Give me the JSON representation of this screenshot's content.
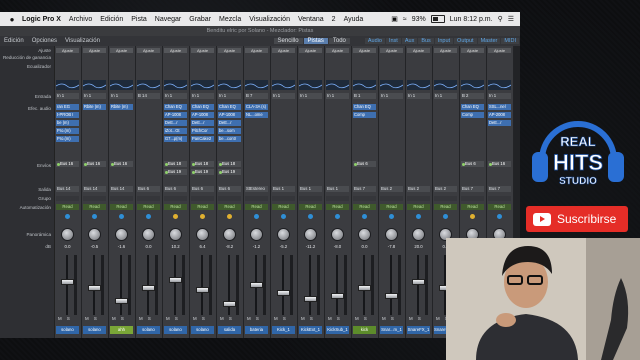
{
  "menubar": {
    "apple": "",
    "app": "Logic Pro X",
    "items": [
      "Archivo",
      "Edición",
      "Pista",
      "Navegar",
      "Grabar",
      "Mezcla",
      "Visualización",
      "Ventana",
      "2",
      "Ayuda"
    ],
    "battery": "93%",
    "clock": "Lun 8:12 p.m."
  },
  "window": {
    "title": "Benditu elric por Solano - Mezclador: Pistas",
    "toolbar": {
      "edit": "Edición",
      "options": "Opciones",
      "view": "Visualización",
      "modes": [
        "Sencillo",
        "Pistas",
        "Todo"
      ],
      "active_mode": "Pistas",
      "filters": [
        "Audio",
        "Inst",
        "Aux",
        "Bus",
        "Input",
        "Output",
        "Master",
        "MIDI"
      ]
    }
  },
  "row_labels": [
    {
      "key": "ajuste",
      "text": "Ajuste"
    },
    {
      "key": "gain",
      "text": "Reducción de ganancia"
    },
    {
      "key": "ecual",
      "text": "Ecualizador"
    },
    {
      "key": "entrada",
      "text": "Entrada"
    },
    {
      "key": "efectos",
      "text": "Efec. audio"
    },
    {
      "key": "envios",
      "text": "Envíos"
    },
    {
      "key": "salida",
      "text": "Salida"
    },
    {
      "key": "grupo",
      "text": "Grupo"
    },
    {
      "key": "auto",
      "text": "Automatización"
    },
    {
      "key": "pan",
      "text": "Panorámica"
    },
    {
      "key": "db",
      "text": "dB"
    }
  ],
  "strips": [
    {
      "setting": "Ajuste",
      "input": "In 1",
      "plugins": [
        "ran EG",
        "t-PROB I",
        "be (m)",
        "Pro.(m)",
        "Pro.(m)"
      ],
      "sends": [
        "Bus 16"
      ],
      "output": "Bus 14",
      "auto": "Read",
      "color": "#2f8fd6",
      "db": "0.0",
      "fader": 0.55,
      "name": "solano",
      "name_style": ""
    },
    {
      "setting": "Ajuste",
      "input": "In 1",
      "plugins": [
        "Rbite (m)"
      ],
      "sends": [
        "Bus 16"
      ],
      "output": "Bus 14",
      "auto": "Read",
      "color": "#2f8fd6",
      "db": "-0.5",
      "fader": 0.45,
      "name": "solano",
      "name_style": ""
    },
    {
      "setting": "Ajuste",
      "input": "In 1",
      "plugins": [
        "Rbite (m)"
      ],
      "sends": [
        "Bus 16"
      ],
      "output": "Bus 14",
      "auto": "Read",
      "color": "#2f8fd6",
      "db": "-1.6",
      "fader": 0.2,
      "name": "ahh",
      "name_style": "green"
    },
    {
      "setting": "Ajuste",
      "input": "B 14",
      "plugins": [],
      "sends": [],
      "output": "Bus 6",
      "auto": "Read",
      "color": "#2f8fd6",
      "db": "0.0",
      "fader": 0.45,
      "name": "solano",
      "name_style": ""
    },
    {
      "setting": "Ajuste",
      "input": "In 1",
      "plugins": [
        "Chan EQ",
        "AP-1008",
        "DeE...r",
        "iZot...Gt",
        "G7...p(m)"
      ],
      "sends": [
        "Bus 18",
        "Bus 19"
      ],
      "output": "Bus 6",
      "auto": "Read",
      "color": "#e0b030",
      "db": "10.2",
      "fader": 0.6,
      "name": "solano",
      "name_style": ""
    },
    {
      "setting": "Ajuste",
      "input": "In 1",
      "plugins": [
        "Chan EQ",
        "AP-1008",
        "DeE...r",
        "PitchCor",
        "PanCake2"
      ],
      "sends": [
        "Bus 18",
        "Bus 19"
      ],
      "output": "Bus 6",
      "auto": "Read",
      "color": "#e0b030",
      "db": "6.4",
      "fader": 0.4,
      "name": "solano",
      "name_style": ""
    },
    {
      "setting": "Ajuste",
      "input": "In 1",
      "plugins": [
        "Chan EQ",
        "AP-1008",
        "DeE...r",
        "be...som",
        "be...contr"
      ],
      "sends": [
        "Bus 18",
        "Bus 19"
      ],
      "output": "Bus 6",
      "auto": "Read",
      "color": "#e0b030",
      "db": "-8.2",
      "fader": 0.15,
      "name": "salida",
      "name_style": ""
    },
    {
      "setting": "Ajuste",
      "input": "B 7",
      "plugins": [
        "CLA-3A (s)",
        "NL...ome"
      ],
      "sends": [],
      "output": "StEstereo",
      "auto": "Read",
      "color": "#2f8fd6",
      "db": "-1.2",
      "fader": 0.5,
      "name": "bateria",
      "name_style": ""
    },
    {
      "setting": "Ajuste",
      "input": "In 1",
      "plugins": [],
      "sends": [],
      "output": "Bus 1",
      "auto": "Read",
      "color": "#2f8fd6",
      "db": "-5.2",
      "fader": 0.35,
      "name": "Kick_1",
      "name_style": ""
    },
    {
      "setting": "Ajuste",
      "input": "In 1",
      "plugins": [],
      "sends": [],
      "output": "Bus 1",
      "auto": "Read",
      "color": "#2f8fd6",
      "db": "-11.2",
      "fader": 0.25,
      "name": "KickExt_1",
      "name_style": ""
    },
    {
      "setting": "Ajuste",
      "input": "In 1",
      "plugins": [],
      "sends": [],
      "output": "Bus 1",
      "auto": "Read",
      "color": "#2f8fd6",
      "db": "-8.0",
      "fader": 0.3,
      "name": "KickSub_1",
      "name_style": ""
    },
    {
      "setting": "Ajuste",
      "input": "B 1",
      "plugins": [
        "Chan EQ",
        "Comp"
      ],
      "sends": [
        "Bus 6"
      ],
      "output": "Bus 7",
      "auto": "Read",
      "color": "#2f8fd6",
      "db": "0.0",
      "fader": 0.45,
      "name": "kick",
      "name_style": "lime"
    },
    {
      "setting": "Ajuste",
      "input": "In 1",
      "plugins": [],
      "sends": [],
      "output": "Bus 2",
      "auto": "Read",
      "color": "#2f8fd6",
      "db": "-7.8",
      "fader": 0.3,
      "name": "Snar...m_1",
      "name_style": ""
    },
    {
      "setting": "Ajuste",
      "input": "In 1",
      "plugins": [],
      "sends": [],
      "output": "Bus 2",
      "auto": "Read",
      "color": "#2f8fd6",
      "db": "20.0",
      "fader": 0.55,
      "name": "SnareFX_1",
      "name_style": ""
    },
    {
      "setting": "Ajuste",
      "input": "In 1",
      "plugins": [],
      "sends": [],
      "output": "Bus 2",
      "auto": "Read",
      "color": "#2f8fd6",
      "db": "0.0",
      "fader": 0.45,
      "name": "SnareTop_1",
      "name_style": ""
    },
    {
      "setting": "Ajuste",
      "input": "B 2",
      "plugins": [
        "Chan EQ",
        "Comp"
      ],
      "sends": [
        "Bus 6"
      ],
      "output": "Bus 7",
      "auto": "Read",
      "color": "#e0b030",
      "db": "-5.1",
      "fader": 0.35,
      "name": "snare",
      "name_style": "lime"
    },
    {
      "setting": "Ajuste",
      "input": "In 1",
      "plugins": [
        "SSL...nel",
        "AP-2008",
        "DeE...r"
      ],
      "sends": [
        "Bus 16"
      ],
      "output": "Bus 7",
      "auto": "Read",
      "color": "#2f8fd6",
      "db": "-7.0",
      "fader": 0.3,
      "name": "hihat",
      "name_style": ""
    }
  ],
  "branding": {
    "logo_top": "REAL",
    "logo_mid": "HITS",
    "logo_bottom": "STUDIO",
    "subscribe": "Suscribirse"
  },
  "colors": {
    "accent_blue": "#3066a8",
    "subscribe_red": "#e52d27",
    "logo_blue": "#2a6fd4"
  }
}
